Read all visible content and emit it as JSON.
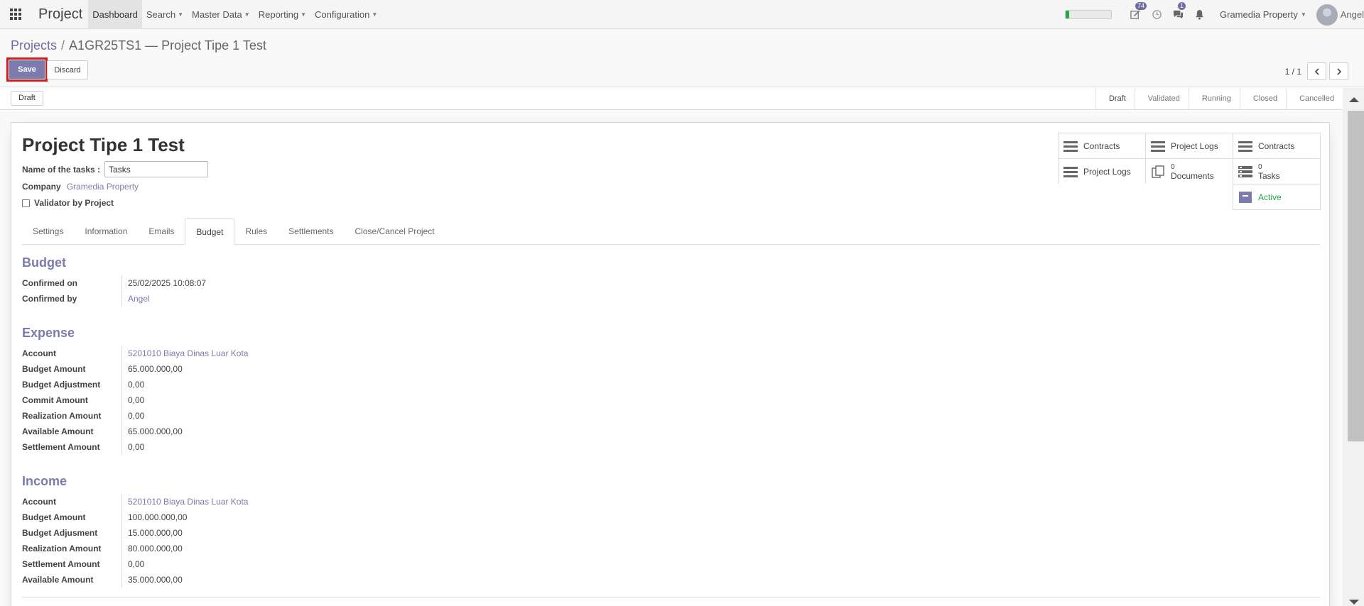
{
  "navbar": {
    "app_name": "Project",
    "menus": [
      "Dashboard",
      "Search",
      "Master Data",
      "Reporting",
      "Configuration"
    ],
    "progress_fraction": 0.08,
    "badge_activities": "74",
    "badge_messages": "1",
    "company": "Gramedia Property",
    "user": "Angel"
  },
  "breadcrumb": {
    "parent": "Projects",
    "separator": "/",
    "current": "A1GR25TS1 — Project Tipe 1 Test"
  },
  "buttons": {
    "save": "Save",
    "discard": "Discard"
  },
  "pager": {
    "value": "1 / 1"
  },
  "status": {
    "state_button": "Draft",
    "stages": [
      "Draft",
      "Validated",
      "Running",
      "Closed",
      "Cancelled"
    ]
  },
  "record": {
    "title": "Project Tipe 1 Test",
    "tasks_label": "Name of the tasks :",
    "tasks_value": "Tasks",
    "company_label": "Company",
    "company_value": "Gramedia Property",
    "validator_label": "Validator by Project"
  },
  "smart_buttons": {
    "contracts_1": "Contracts",
    "project_logs_1": "Project Logs",
    "contracts_2": "Contracts",
    "project_logs_2": "Project Logs",
    "documents_count": "0",
    "documents_label": "Documents",
    "tasks_count": "0",
    "tasks_label": "Tasks",
    "active_label": "Active"
  },
  "tabs": [
    "Settings",
    "Information",
    "Emails",
    "Budget",
    "Rules",
    "Settlements",
    "Close/Cancel Project"
  ],
  "budget": {
    "title": "Budget",
    "rows": [
      {
        "label": "Confirmed on",
        "value": "25/02/2025 10:08:07"
      },
      {
        "label": "Confirmed by",
        "value": "Angel"
      }
    ]
  },
  "expense": {
    "title": "Expense",
    "rows": [
      {
        "label": "Account",
        "value": "5201010 Biaya Dinas Luar Kota"
      },
      {
        "label": "Budget Amount",
        "value": "65.000.000,00"
      },
      {
        "label": "Budget Adjustment",
        "value": "0,00"
      },
      {
        "label": "Commit Amount",
        "value": "0,00"
      },
      {
        "label": "Realization Amount",
        "value": "0,00"
      },
      {
        "label": "Available Amount",
        "value": "65.000.000,00"
      },
      {
        "label": "Settlement Amount",
        "value": "0,00"
      }
    ]
  },
  "income": {
    "title": "Income",
    "rows": [
      {
        "label": "Account",
        "value": "5201010 Biaya Dinas Luar Kota"
      },
      {
        "label": "Budget Amount",
        "value": "100.000.000,00"
      },
      {
        "label": "Budget Adjusment",
        "value": "15.000.000,00"
      },
      {
        "label": "Realization Amount",
        "value": "80.000.000,00"
      },
      {
        "label": "Settlement Amount",
        "value": "0,00"
      },
      {
        "label": "Available Amount",
        "value": "35.000.000,00"
      }
    ]
  },
  "colors": {
    "brand": "#7c7bad",
    "save_highlight": "#d4181f",
    "active": "#28a745"
  }
}
